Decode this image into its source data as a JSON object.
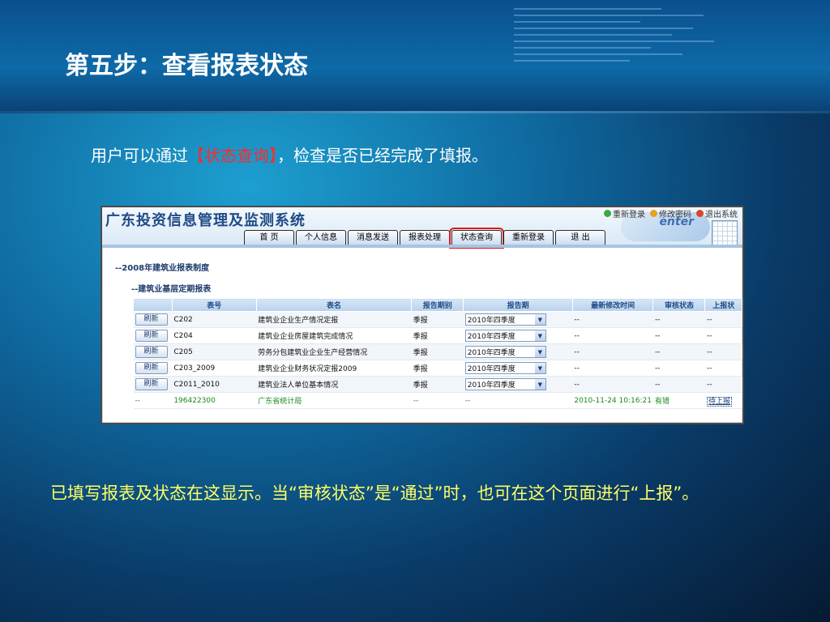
{
  "slide": {
    "title": "第五步：查看报表状态",
    "intro_prefix": "用户可以通过",
    "intro_highlight": "【状态查询】",
    "intro_suffix": "，检查是否已经完成了填报。",
    "note": "已填写报表及状态在这显示。当“审核状态”是“通过”时，也可在这个页面进行“上报”。"
  },
  "app": {
    "title": "广东投资信息管理及监测系统",
    "top_links": [
      "重新登录",
      "修改密码",
      "退出系统"
    ],
    "logo_text": "enter",
    "nav": [
      "首 页",
      "个人信息",
      "消息发送",
      "报表处理",
      "状态查询",
      "重新登录",
      "退 出"
    ],
    "active_nav_index": 4,
    "breadcrumb_1": "--2008年建筑业报表制度",
    "breadcrumb_2": "--建筑业基层定期报表"
  },
  "table": {
    "columns": [
      "",
      "表号",
      "表名",
      "报告期别",
      "报告期",
      "最新修改时间",
      "审核状态",
      "上报状"
    ],
    "refresh_label": "刷新",
    "rows": [
      {
        "code": "C202",
        "name": "建筑业企业生产情况定报",
        "period_type": "季报",
        "period": "2010年四季度",
        "modified": "--",
        "status": "--",
        "report": "--"
      },
      {
        "code": "C204",
        "name": "建筑业企业房屋建筑完成情况",
        "period_type": "季报",
        "period": "2010年四季度",
        "modified": "--",
        "status": "--",
        "report": "--"
      },
      {
        "code": "C205",
        "name": "劳务分包建筑业企业生产经营情况",
        "period_type": "季报",
        "period": "2010年四季度",
        "modified": "--",
        "status": "--",
        "report": "--"
      },
      {
        "code": "C203_2009",
        "name": "建筑业企业财务状况定报2009",
        "period_type": "季报",
        "period": "2010年四季度",
        "modified": "--",
        "status": "--",
        "report": "--"
      },
      {
        "code": "C2011_2010",
        "name": "建筑业法人单位基本情况",
        "period_type": "季报",
        "period": "2010年四季度",
        "modified": "--",
        "status": "--",
        "report": "--"
      }
    ],
    "summary": {
      "col0": "--",
      "code": "196422300",
      "name": "广东省统计局",
      "period_type": "--",
      "period": "--",
      "modified": "2010-11-24 10:16:21",
      "status": "有错",
      "report": "待上报"
    }
  }
}
